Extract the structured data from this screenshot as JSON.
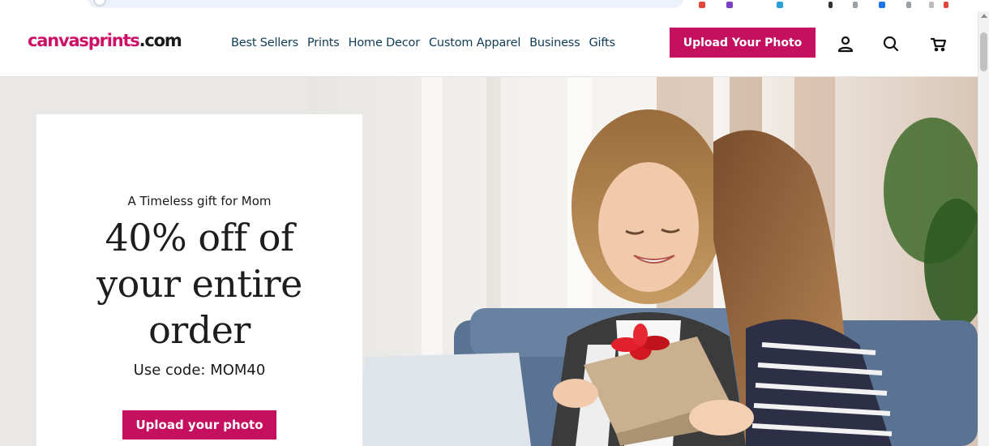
{
  "brand": {
    "logo_main": "canvasprints",
    "logo_tld": ".com",
    "accent_color": "#c4105f",
    "nav_text_color": "#0f3b54"
  },
  "nav": {
    "items": [
      {
        "label": "Best Sellers"
      },
      {
        "label": "Prints"
      },
      {
        "label": "Home Decor"
      },
      {
        "label": "Custom Apparel"
      },
      {
        "label": "Business"
      },
      {
        "label": "Gifts"
      }
    ]
  },
  "header": {
    "upload_label": "Upload Your Photo",
    "icons": [
      "account-icon",
      "search-icon",
      "cart-icon"
    ]
  },
  "hero": {
    "kicker": "A Timeless gift for Mom",
    "headline": "40% off of your entire order",
    "code_text": "Use code: MOM40",
    "cta_label": "Upload your photo"
  }
}
